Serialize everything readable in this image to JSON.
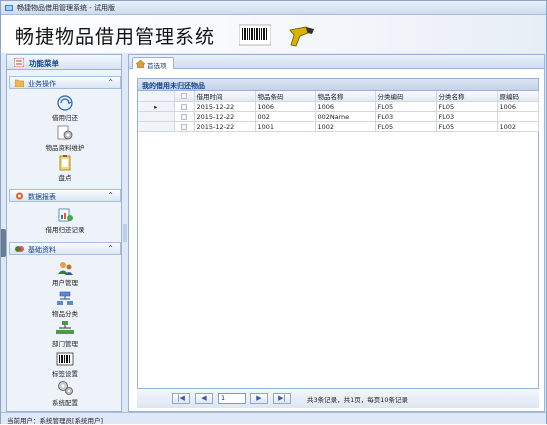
{
  "window": {
    "title": "畅捷物品借用管理系统 - 试用版"
  },
  "banner": {
    "title": "畅捷物品借用管理系统"
  },
  "sidebar": {
    "header": "功能菜单",
    "sections": [
      {
        "label": "业务操作",
        "items": [
          {
            "label": "借用归还",
            "icon": "borrow-return-icon"
          },
          {
            "label": "物品资料维护",
            "icon": "gear-icon"
          },
          {
            "label": "盘点",
            "icon": "clipboard-icon"
          }
        ]
      },
      {
        "label": "数据报表",
        "items": [
          {
            "label": "借用归还记录",
            "icon": "report-icon"
          }
        ]
      },
      {
        "label": "基础资料",
        "items": [
          {
            "label": "用户管理",
            "icon": "users-icon"
          },
          {
            "label": "物品分类",
            "icon": "category-icon"
          },
          {
            "label": "部门管理",
            "icon": "org-chart-icon"
          },
          {
            "label": "标签设置",
            "icon": "barcode-icon"
          },
          {
            "label": "系统配置",
            "icon": "gears-icon"
          }
        ]
      }
    ]
  },
  "tabs": [
    {
      "label": "首选项",
      "icon": "home-icon"
    }
  ],
  "panel": {
    "title": "我的借用未归还物品"
  },
  "table": {
    "columns": [
      "借用时间",
      "物品条码",
      "物品名称",
      "分类编码",
      "分类名称",
      "原编码"
    ],
    "rows": [
      [
        "2015-12-22",
        "1006",
        "1006",
        "FL05",
        "FL05",
        "1006"
      ],
      [
        "2015-12-22",
        "002",
        "002Name",
        "FL03",
        "FL03",
        ""
      ],
      [
        "2015-12-22",
        "1001",
        "1002",
        "FL05",
        "FL05",
        "1002"
      ]
    ]
  },
  "pager": {
    "page": "1",
    "info": "共3条记录，共1页，每页10条记录"
  },
  "status": {
    "text": "当前用户：系统管理员[系统用户]"
  },
  "colors": {
    "accent": "#15428b",
    "border": "#99b3d6",
    "background": "#dfe8f6"
  }
}
